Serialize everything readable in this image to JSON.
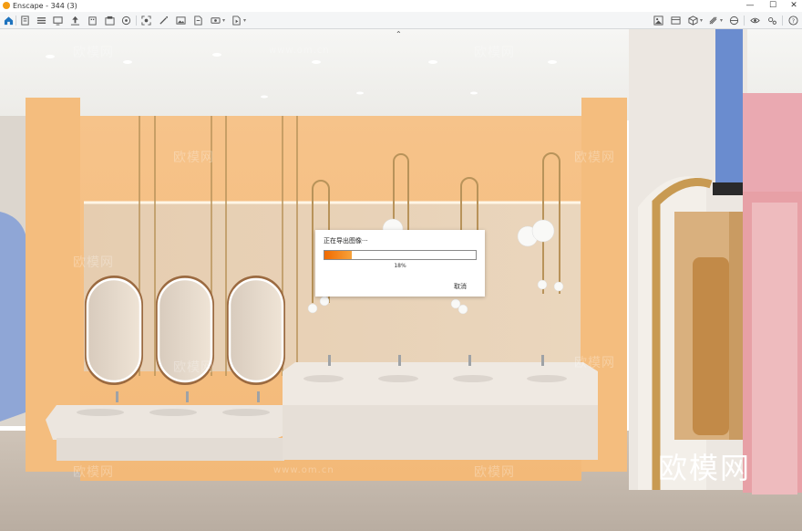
{
  "window": {
    "title": "Enscape - 344 (3)",
    "minimize": "—",
    "maximize": "☐",
    "close": "✕"
  },
  "toolbar": {
    "left_icons": [
      "home-icon",
      "new-file-icon",
      "list-icon",
      "monitor-icon",
      "upload-icon",
      "building-icon",
      "import-icon",
      "save-file-icon",
      "view-preset-icon",
      "screenshot-icon",
      "magic-wand-icon",
      "image-icon",
      "document-export-icon",
      "panorama-icon",
      "video-export-icon"
    ],
    "right_icons": [
      "image-render-icon",
      "asset-icon",
      "cube-icon",
      "material-icon",
      "eye-icon",
      "settings-icon",
      "help-icon"
    ],
    "accent": "#1e73be"
  },
  "viewport": {
    "collapse_symbol": "⌃",
    "watermarks": [
      "欧模网",
      "www.om.cn"
    ],
    "brand_text": "欧模网"
  },
  "export_dialog": {
    "title": "正在导出图像···",
    "progress": 0.18,
    "progress_label": "18%",
    "cancel_label": "取消",
    "fill_color": "#f07a10"
  }
}
